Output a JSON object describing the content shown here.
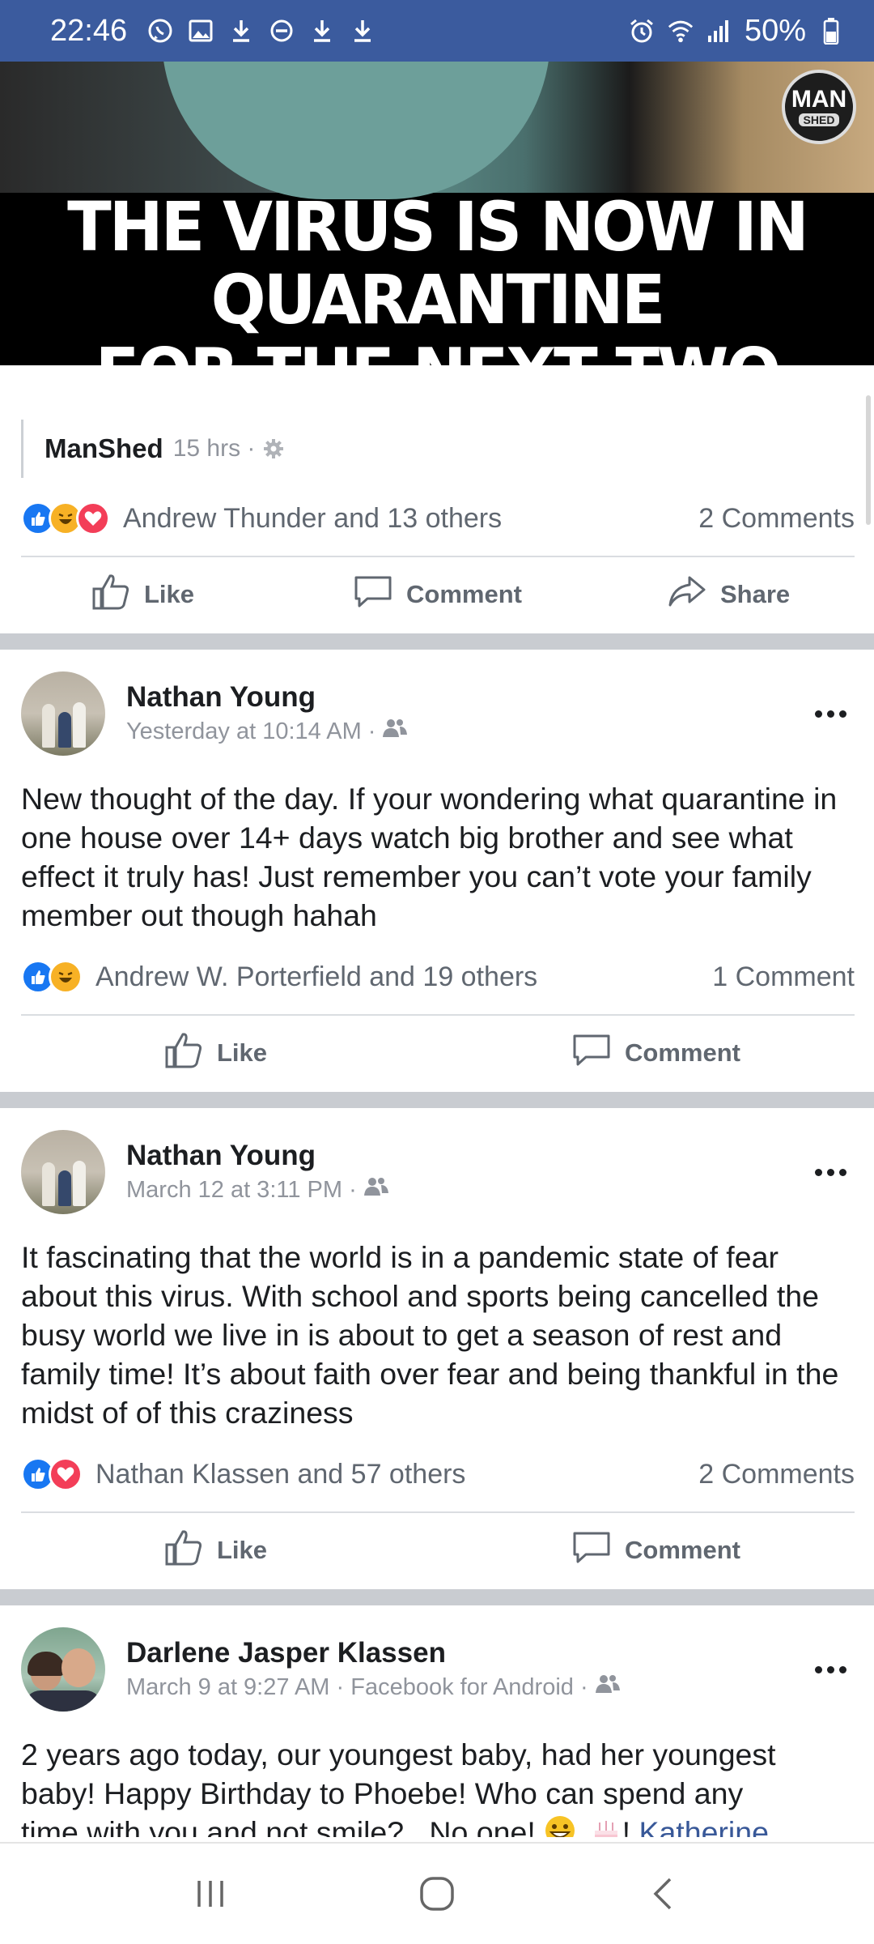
{
  "status_bar": {
    "time": "22:46",
    "battery": "50%",
    "left_icons": [
      "whatsapp-icon",
      "gallery-icon",
      "download-icon",
      "do-not-disturb-icon",
      "download-icon",
      "download-icon"
    ],
    "right_icons": [
      "alarm-icon",
      "wifi-icon",
      "signal-icon",
      "battery-icon"
    ]
  },
  "shared_post": {
    "meme_caption_line1": "THE VIRUS IS NOW IN QUARANTINE",
    "meme_caption_line2": "FOR THE NEXT TWO WEEKS",
    "logo_top": "MAN",
    "logo_bottom": "SHED",
    "source_name": "ManShed",
    "source_time": "15 hrs ·",
    "reactions_text": "Andrew Thunder and 13 others",
    "comments": "2 Comments",
    "reactions": [
      "like",
      "haha",
      "love"
    ],
    "actions": {
      "like": "Like",
      "comment": "Comment",
      "share": "Share"
    }
  },
  "posts": [
    {
      "author": "Nathan Young",
      "time": "Yesterday at 10:14 AM ·",
      "text": "New thought of the day. If your wondering what quarantine in one house over 14+ days watch big brother and see what effect it truly has! Just remember you can’t vote your family member out though hahah",
      "reactions_text": "Andrew W. Porterfield and 19 others",
      "comments": "1 Comment",
      "reactions": [
        "like",
        "haha"
      ],
      "actions": {
        "like": "Like",
        "comment": "Comment"
      }
    },
    {
      "author": "Nathan Young",
      "time": "March 12 at 3:11 PM ·",
      "text": "It fascinating that the world is in a pandemic state of fear about this virus. With school and sports being cancelled the busy world we live in is about to get a season of rest and family time! It’s about faith over fear and being thankful in the midst of of this craziness",
      "reactions_text": "Nathan Klassen and 57 others",
      "comments": "2 Comments",
      "reactions": [
        "like",
        "love"
      ],
      "actions": {
        "like": "Like",
        "comment": "Comment"
      }
    },
    {
      "author": "Darlene Jasper Klassen",
      "time": "March 9 at 9:27 AM · Facebook for Android ·",
      "text_line1": "2 years ago today, our youngest baby, had her youngest",
      "text_line2": "baby! Happy Birthday to Phoebe! Who can spend any",
      "text_line3": "time with you and not smile?...No one!",
      "text_tail": "!",
      "mention": "Katherine"
    }
  ],
  "nav_bar": [
    "recent-apps-icon",
    "home-icon",
    "back-icon"
  ]
}
